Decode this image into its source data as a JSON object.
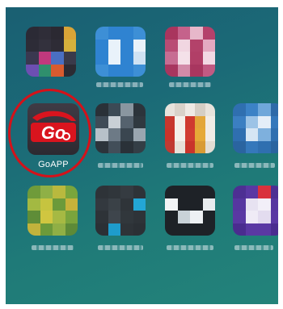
{
  "home_screen": {
    "highlighted_app": {
      "label": "GoAPP",
      "icon_text": "Go",
      "icon": "goapp-logo-icon",
      "highlight_color": "#d4121a"
    },
    "other_apps": [
      {
        "name": "app-1",
        "blurred": true
      },
      {
        "name": "app-2",
        "blurred": true
      },
      {
        "name": "app-3",
        "blurred": true
      },
      {
        "name": "app-4",
        "blurred": true
      },
      {
        "name": "app-5",
        "blurred": true
      },
      {
        "name": "app-6",
        "blurred": true
      },
      {
        "name": "app-7",
        "blurred": true
      },
      {
        "name": "app-8",
        "blurred": true
      },
      {
        "name": "app-9",
        "blurred": true
      },
      {
        "name": "app-10",
        "blurred": true
      }
    ]
  },
  "colors": {
    "wallpaper": "#1b6a77",
    "goapp_red": "#d9141e",
    "goapp_dark": "#34323a"
  }
}
